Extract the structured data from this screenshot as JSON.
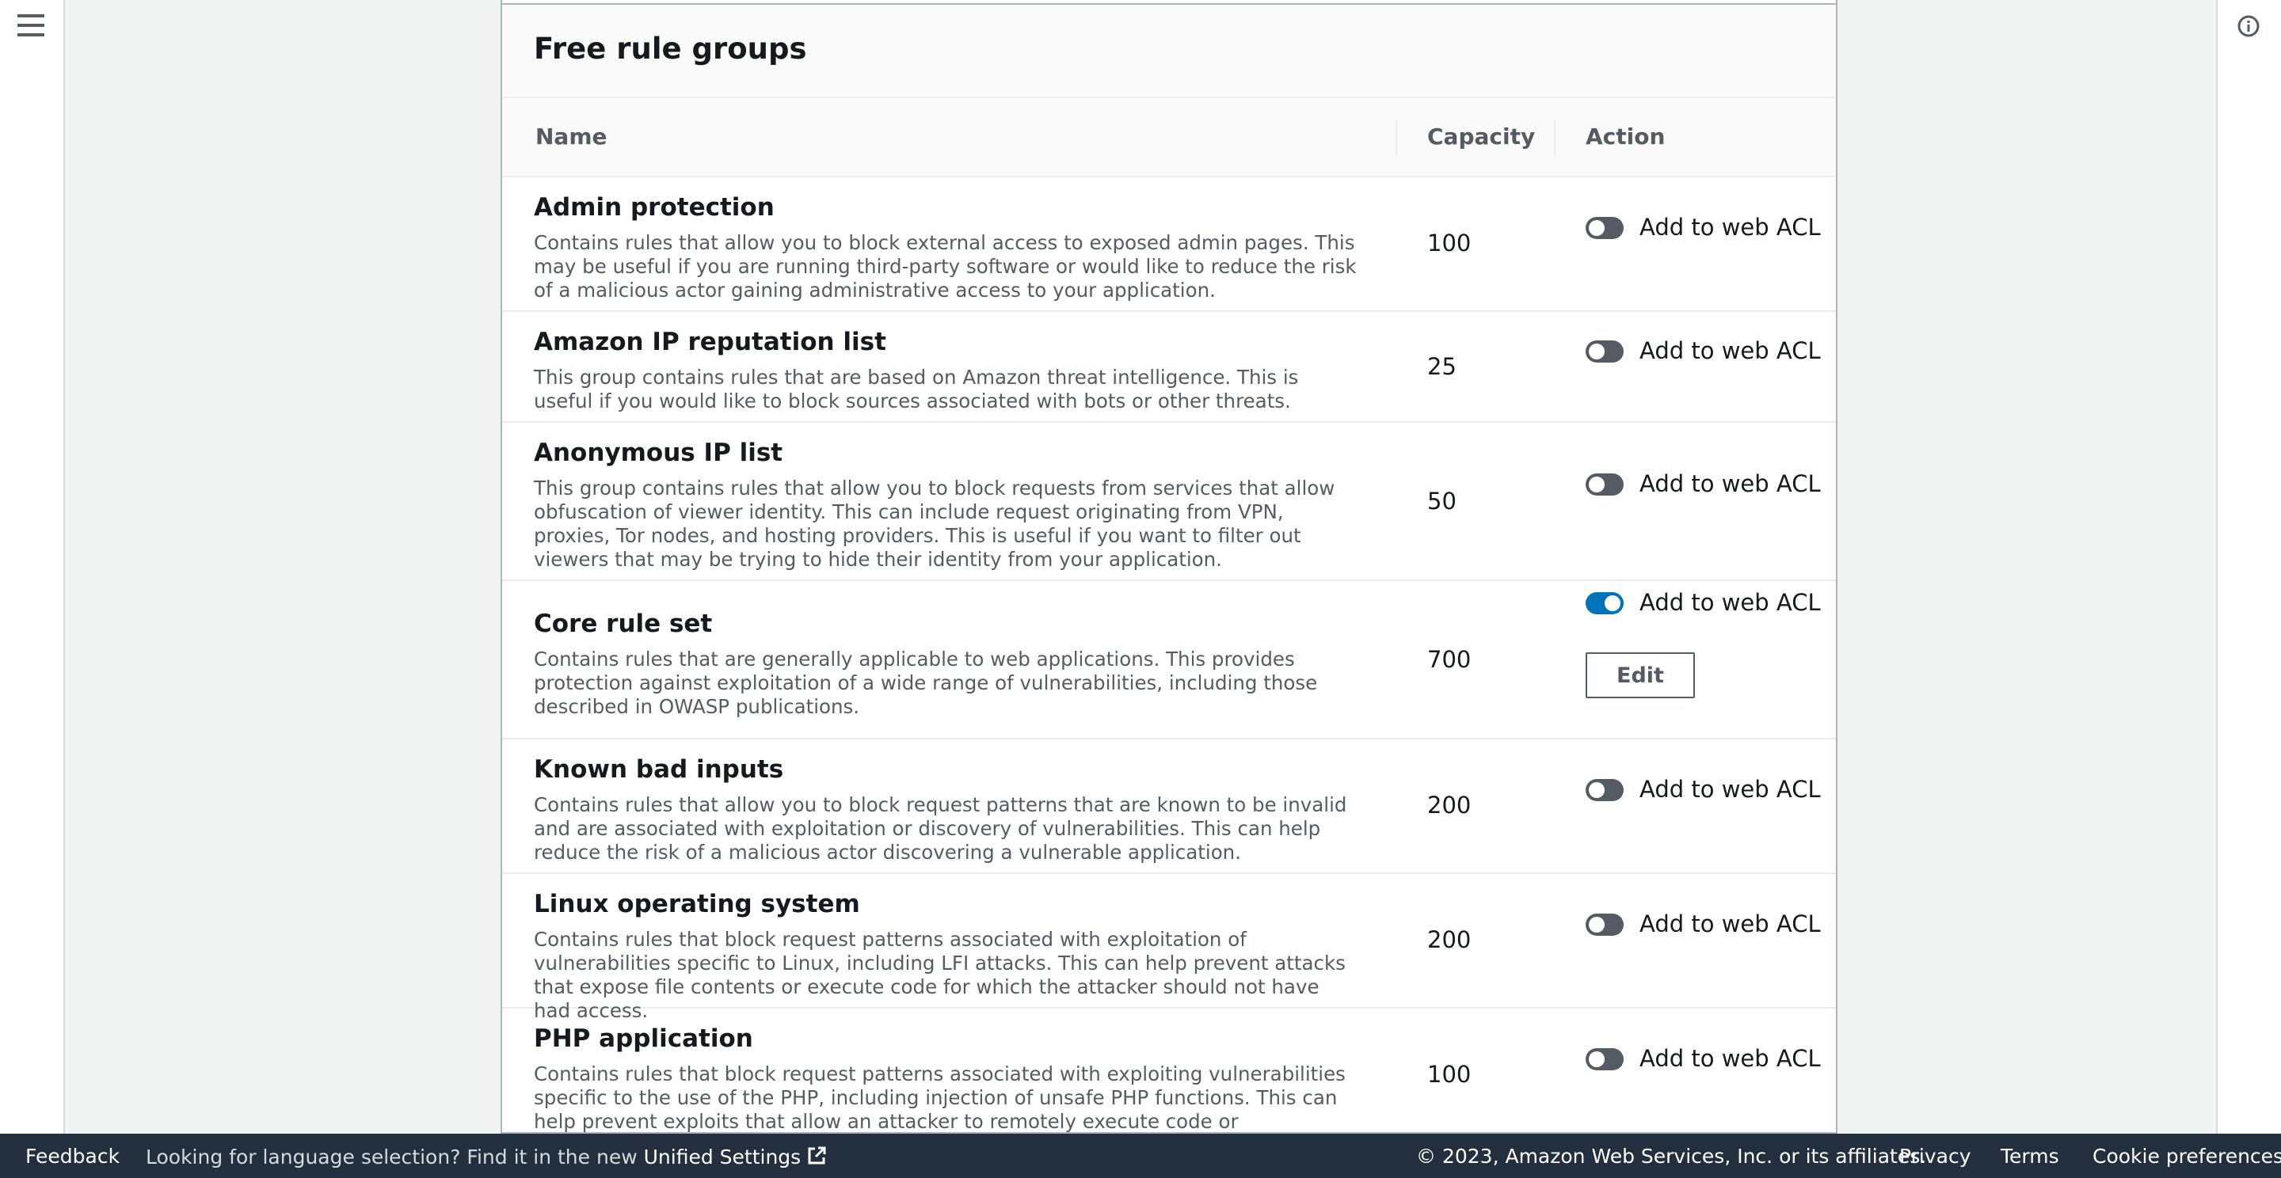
{
  "panel": {
    "title": "Free rule groups",
    "columns": {
      "name": "Name",
      "capacity": "Capacity",
      "action": "Action"
    },
    "rows": [
      {
        "name": "Admin protection",
        "description": "Contains rules that allow you to block external access to exposed admin pages. This may be useful if you are running third-party software or would like to reduce the risk of a malicious actor gaining administrative access to your application.",
        "capacity": "100",
        "toggle_label": "Add to web ACL",
        "enabled": false
      },
      {
        "name": "Amazon IP reputation list",
        "description": "This group contains rules that are based on Amazon threat intelligence. This is useful if you would like to block sources associated with bots or other threats.",
        "capacity": "25",
        "toggle_label": "Add to web ACL",
        "enabled": false
      },
      {
        "name": "Anonymous IP list",
        "description": "This group contains rules that allow you to block requests from services that allow obfuscation of viewer identity. This can include request originating from VPN, proxies, Tor nodes, and hosting providers. This is useful if you want to filter out viewers that may be trying to hide their identity from your application.",
        "capacity": "50",
        "toggle_label": "Add to web ACL",
        "enabled": false
      },
      {
        "name": "Core rule set",
        "description": "Contains rules that are generally applicable to web applications. This provides protection against exploitation of a wide range of vulnerabilities, including those described in OWASP publications.",
        "capacity": "700",
        "toggle_label": "Add to web ACL",
        "enabled": true,
        "edit_label": "Edit"
      },
      {
        "name": "Known bad inputs",
        "description": "Contains rules that allow you to block request patterns that are known to be invalid and are associated with exploitation or discovery of vulnerabilities. This can help reduce the risk of a malicious actor discovering a vulnerable application.",
        "capacity": "200",
        "toggle_label": "Add to web ACL",
        "enabled": false
      },
      {
        "name": "Linux operating system",
        "description": "Contains rules that block request patterns associated with exploitation of vulnerabilities specific to Linux, including LFI attacks. This can help prevent attacks that expose file contents or execute code for which the attacker should not have had access.",
        "capacity": "200",
        "toggle_label": "Add to web ACL",
        "enabled": false
      },
      {
        "name": "PHP application",
        "description": "Contains rules that block request patterns associated with exploiting vulnerabilities specific to the use of the PHP, including injection of unsafe PHP functions. This can help prevent exploits that allow an attacker to remotely execute code or commands.",
        "capacity": "100",
        "toggle_label": "Add to web ACL",
        "enabled": false
      }
    ]
  },
  "footer": {
    "feedback": "Feedback",
    "language_text": "Looking for language selection? Find it in the new",
    "unified_settings": "Unified Settings",
    "copyright": "© 2023, Amazon Web Services, Inc. or its affiliates.",
    "privacy": "Privacy",
    "terms": "Terms",
    "cookie_preferences": "Cookie preferences"
  },
  "icons": {
    "menu": "hamburger-menu-icon",
    "info": "info-icon",
    "external": "external-link-icon"
  },
  "colors": {
    "toggle_on": "#0073bb",
    "toggle_off": "#545b64",
    "footer_bg": "#232f3e"
  }
}
